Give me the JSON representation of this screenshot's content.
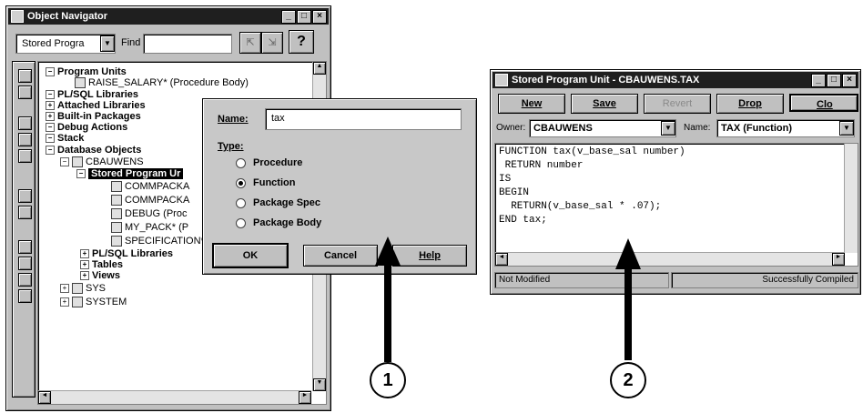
{
  "navigator": {
    "title": "Object Navigator",
    "dropdown_value": "Stored Progra",
    "find_label": "Find",
    "help_label": "?",
    "tree": [
      {
        "label": "Program Units",
        "bold": true
      },
      {
        "label": "RAISE_SALARY* (Procedure Body)",
        "bold": false
      },
      {
        "label": "PL/SQL Libraries",
        "bold": true
      },
      {
        "label": "Attached Libraries",
        "bold": true
      },
      {
        "label": "Built-in Packages",
        "bold": true
      },
      {
        "label": "Debug Actions",
        "bold": true
      },
      {
        "label": "Stack",
        "bold": true
      },
      {
        "label": "Database Objects",
        "bold": true
      },
      {
        "label": "CBAUWENS",
        "bold": false
      },
      {
        "label": "Stored Program Ur",
        "bold": true
      },
      {
        "label": "COMMPACKA",
        "bold": false
      },
      {
        "label": "COMMPACKA",
        "bold": false
      },
      {
        "label": "DEBUG (Proc",
        "bold": false
      },
      {
        "label": "MY_PACK* (P",
        "bold": false
      },
      {
        "label": "SPECIFICATION* (Package Spec)",
        "bold": false
      },
      {
        "label": "PL/SQL Libraries",
        "bold": true
      },
      {
        "label": "Tables",
        "bold": true
      },
      {
        "label": "Views",
        "bold": true
      },
      {
        "label": "SYS",
        "bold": false
      },
      {
        "label": "SYSTEM",
        "bold": false
      }
    ]
  },
  "dialog": {
    "name_label": "Name:",
    "name_value": "tax",
    "type_label": "Type:",
    "options": [
      "Procedure",
      "Function",
      "Package Spec",
      "Package Body"
    ],
    "selected": "Function",
    "ok": "OK",
    "cancel": "Cancel",
    "help": "Help"
  },
  "editor": {
    "title": "Stored Program Unit - CBAUWENS.TAX",
    "buttons": [
      "New",
      "Save",
      "Revert",
      "Drop",
      "Clo"
    ],
    "owner_label": "Owner:",
    "owner_value": "CBAUWENS",
    "name_label": "Name:",
    "name_value": "TAX (Function)",
    "code": [
      "FUNCTION tax(v_base_sal number)",
      " RETURN number",
      "IS",
      "BEGIN",
      "  RETURN(v_base_sal * .07);",
      "END tax;"
    ],
    "status_left": "Not Modified",
    "status_right": "Successfully Compiled"
  },
  "callouts": [
    "1",
    "2"
  ]
}
